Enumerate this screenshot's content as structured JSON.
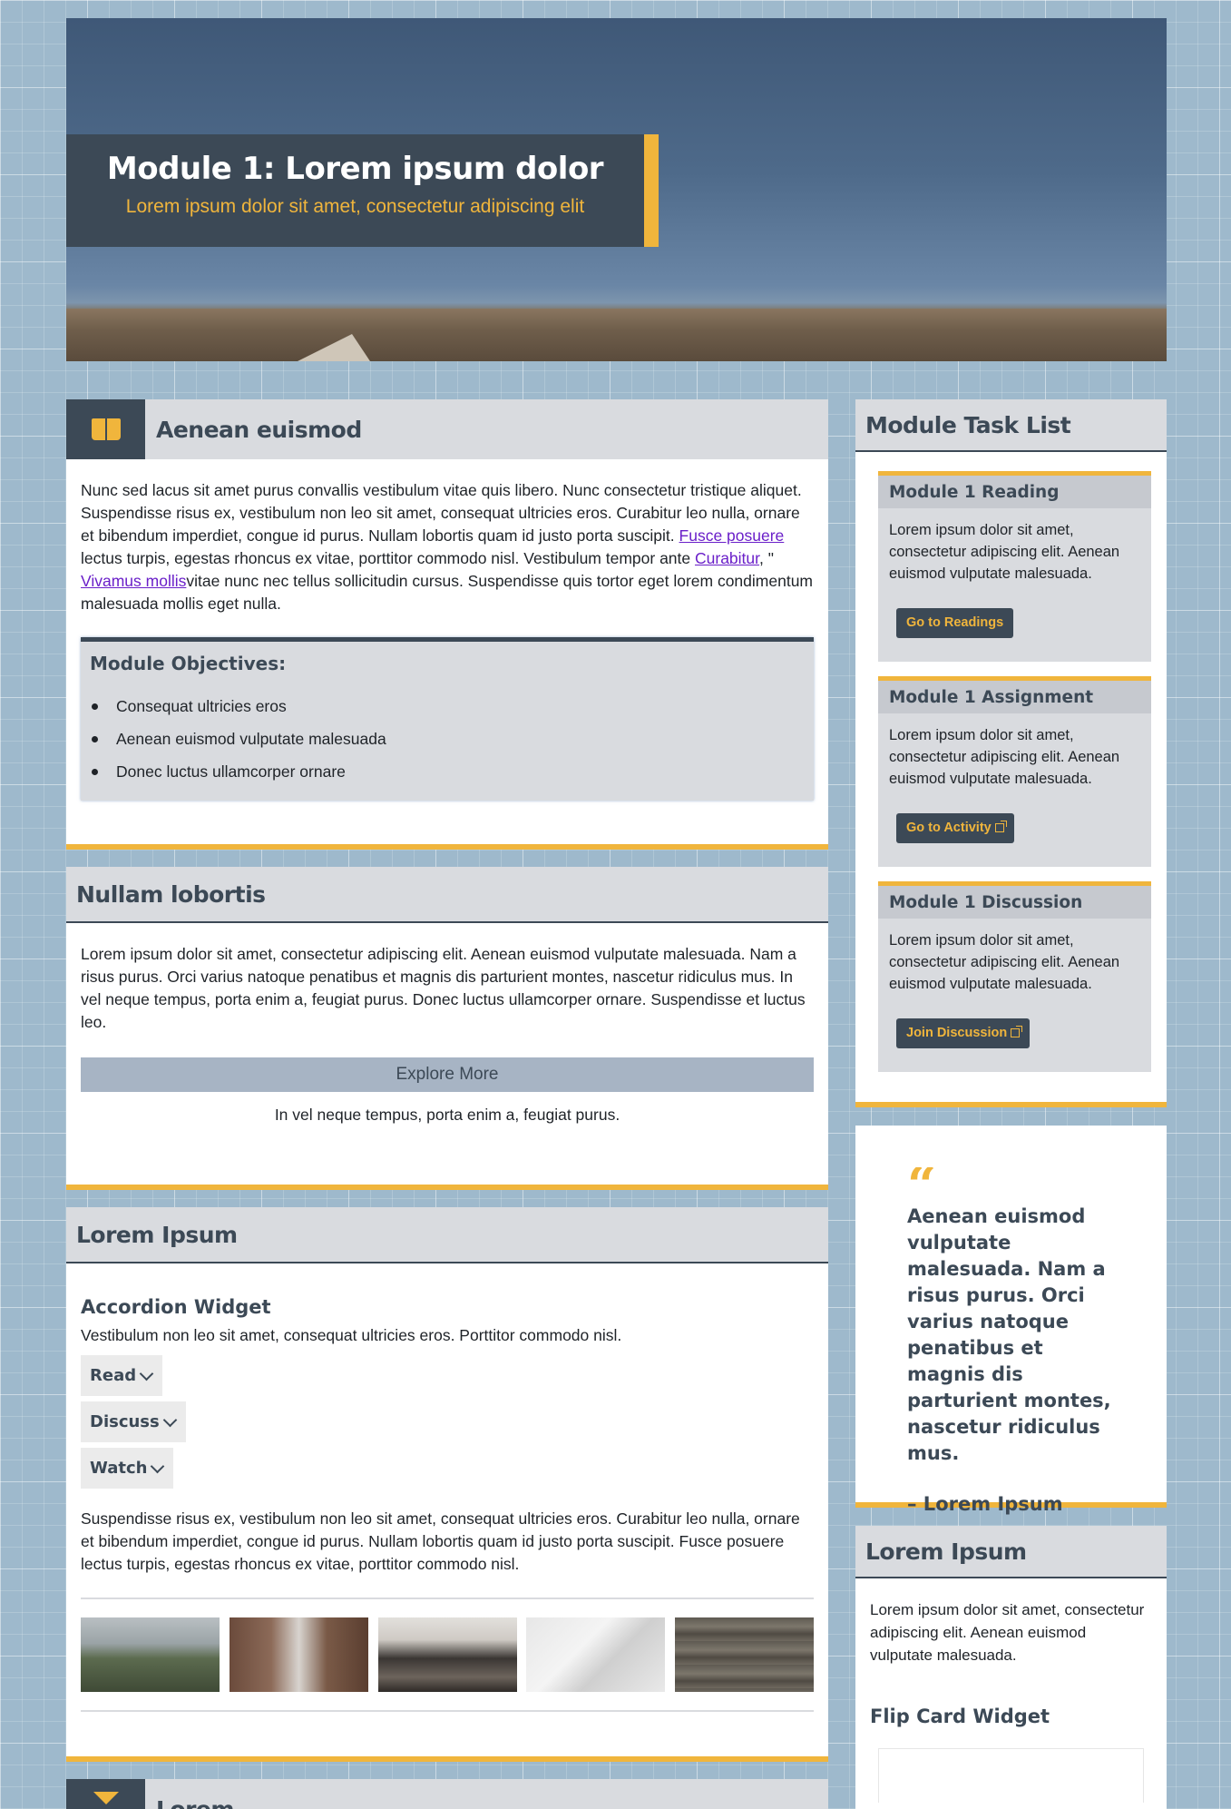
{
  "hero": {
    "title": "Module 1: Lorem ipsum dolor",
    "subtitle": "Lorem ipsum dolor sit amet, consectetur adipiscing elit"
  },
  "section1": {
    "title": "Aenean euismod",
    "icon": "book-open-icon",
    "para_a": "Nunc sed lacus sit amet purus convallis vestibulum vitae quis libero. Nunc consectetur tristique aliquet. Suspendisse risus ex, vestibulum non leo sit amet, consequat ultricies eros. Curabitur leo nulla, ornare et bibendum imperdiet, congue id purus. Nullam lobortis quam id justo porta suscipit.",
    "link1": "Fusce posuere",
    "para_b": " lectus turpis, egestas rhoncus ex vitae, porttitor commodo nisl. Vestibulum tempor ante ",
    "link2": "Curabitur",
    "para_c": ", \" ",
    "link3": "Vivamus mollis",
    "para_d": "vitae nunc nec tellus sollicitudin cursus. Suspendisse quis tortor eget lorem condimentum malesuada mollis eget nulla.",
    "objectives_title": "Module Objectives:",
    "objectives": [
      "Consequat ultricies eros",
      "Aenean euismod vulputate malesuada",
      "Donec luctus ullamcorper ornare"
    ]
  },
  "section2": {
    "title": "Nullam lobortis",
    "text": "Lorem ipsum dolor sit amet, consectetur adipiscing elit. Aenean euismod vulputate malesuada. Nam a risus purus. Orci varius natoque penatibus et magnis dis parturient montes, nascetur ridiculus mus. In vel neque tempus, porta enim a, feugiat purus. Donec luctus ullamcorper ornare. Suspendisse et luctus leo.",
    "button": "Explore More",
    "caption": "In vel neque tempus, porta enim a, feugiat purus."
  },
  "section3": {
    "title": "Lorem Ipsum",
    "accordion_title": "Accordion Widget",
    "accordion_intro": "Vestibulum non leo sit amet, consequat ultricies eros. Porttitor commodo nisl.",
    "accordion_items": [
      "Read",
      "Discuss",
      "Watch"
    ],
    "text": "Suspendisse risus ex, vestibulum non leo sit amet, consequat ultricies eros. Curabitur leo nulla, ornare et bibendum imperdiet, congue id purus. Nullam lobortis quam id justo porta suscipit. Fusce posuere lectus turpis, egestas rhoncus ex vitae, porttitor commodo nisl."
  },
  "section4": {
    "title": "Lorem",
    "icon": "hourglass-icon"
  },
  "task_list": {
    "title": "Module Task List",
    "tasks": [
      {
        "title": "Module 1 Reading",
        "text": "Lorem ipsum dolor sit amet, consectetur adipiscing elit. Aenean euismod vulputate malesuada.",
        "button": "Go to Readings"
      },
      {
        "title": "Module 1 Assignment",
        "text": "Lorem ipsum dolor sit amet, consectetur adipiscing elit. Aenean euismod vulputate malesuada.",
        "button": "Go to Activity"
      },
      {
        "title": "Module 1 Discussion",
        "text": "Lorem ipsum dolor sit amet, consectetur adipiscing elit. Aenean euismod vulputate malesuada.",
        "button": "Join Discussion"
      }
    ]
  },
  "quote": {
    "mark": "“",
    "text": "Aenean euismod vulputate malesuada. Nam a risus purus. Orci varius natoque penatibus et magnis dis parturient montes, nascetur ridiculus mus.",
    "author": "– Lorem Ipsum"
  },
  "side_card": {
    "title": "Lorem Ipsum",
    "text": "Lorem ipsum dolor sit amet, consectetur adipiscing elit. Aenean euismod vulputate malesuada.",
    "flip_title": "Flip Card Widget"
  },
  "colors": {
    "accent": "#f0b53c",
    "dark": "#3c4956",
    "panel": "#d9dbdf",
    "link": "#6a1fc9"
  }
}
